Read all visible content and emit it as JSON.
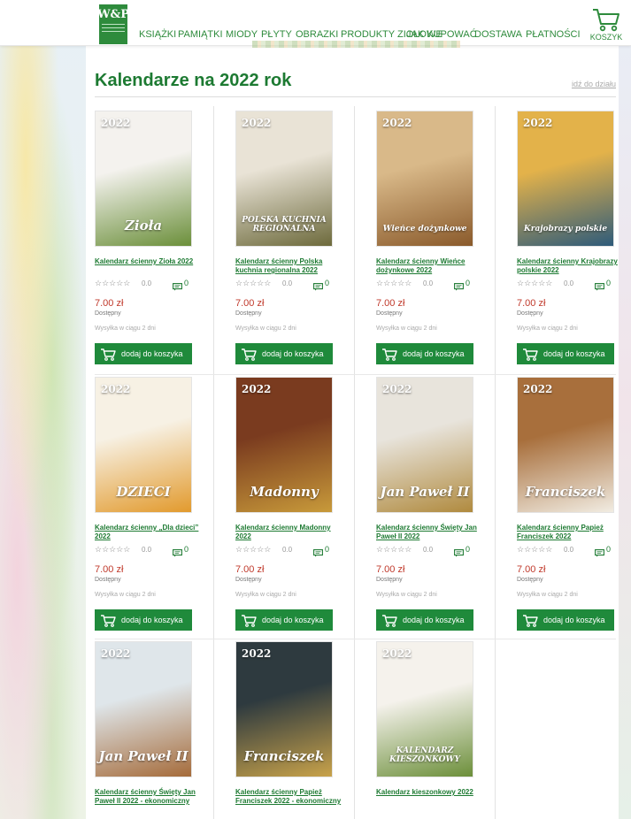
{
  "header": {
    "logo_text": "W&P",
    "nav": [
      {
        "label": "KSIĄŻKI"
      },
      {
        "label": "PAMIĄTKI"
      },
      {
        "label": "MIODY"
      },
      {
        "label": "PŁYTY"
      },
      {
        "label": "OBRAZKI"
      },
      {
        "label": "PRODUKTY ZIOŁOWE"
      },
      {
        "label": "JAK KUPOWAĆ"
      },
      {
        "label": "DOSTAWA"
      },
      {
        "label": "PŁATNOŚCI"
      }
    ],
    "cart_label": "KOSZYK"
  },
  "page": {
    "title": "Kalendarze na 2022 rok",
    "goto_label": "idź do działu"
  },
  "products": [
    {
      "name": "Kalendarz ścienny Zioła 2022",
      "cover_title": "Zioła",
      "cover_year": "2022",
      "rating": "0.0",
      "comments": "0",
      "price": "7.00 zł",
      "availability": "Dostępny",
      "shipping": "Wysyłka w ciągu 2 dni",
      "button": "dodaj do koszyka",
      "colors": [
        "#f4f2ee",
        "#6b8f3a"
      ]
    },
    {
      "name": "Kalendarz ścienny Polska kuchnia regionalna 2022",
      "cover_title": "POLSKA KUCHNIA REGIONALNA",
      "cover_year": "2022",
      "rating": "0.0",
      "comments": "0",
      "price": "7.00 zł",
      "availability": "Dostępny",
      "shipping": "Wysyłka w ciągu 2 dni",
      "button": "dodaj do koszyka",
      "colors": [
        "#e9e3d6",
        "#6d6a3c"
      ]
    },
    {
      "name": "Kalendarz ścienny Wieńce dożynkowe 2022",
      "cover_title": "Wieńce dożynkowe",
      "cover_year": "2022",
      "rating": "0.0",
      "comments": "0",
      "price": "7.00 zł",
      "availability": "Dostępny",
      "shipping": "Wysyłka w ciągu 2 dni",
      "button": "dodaj do koszyka",
      "colors": [
        "#d9b989",
        "#8a5a2b"
      ]
    },
    {
      "name": "Kalendarz ścienny Krajobrazy polskie 2022",
      "cover_title": "Krajobrazy polskie",
      "cover_year": "2022",
      "rating": "0.0",
      "comments": "0",
      "price": "7.00 zł",
      "availability": "Dostępny",
      "shipping": "Wysyłka w ciągu 2 dni",
      "button": "dodaj do koszyka",
      "colors": [
        "#e3b24a",
        "#2e5b7a"
      ]
    },
    {
      "name": "Kalendarz ścienny „Dla dzieci” 2022",
      "cover_title": "DZIECI",
      "cover_year": "2022",
      "rating": "0.0",
      "comments": "0",
      "price": "7.00 zł",
      "availability": "Dostępny",
      "shipping": "Wysyłka w ciągu 2 dni",
      "button": "dodaj do koszyka",
      "colors": [
        "#f7f1e4",
        "#e29a2d"
      ]
    },
    {
      "name": "Kalendarz ścienny Madonny 2022",
      "cover_title": "Madonny",
      "cover_year": "2022",
      "rating": "0.0",
      "comments": "0",
      "price": "7.00 zł",
      "availability": "Dostępny",
      "shipping": "Wysyłka w ciągu 2 dni",
      "button": "dodaj do koszyka",
      "colors": [
        "#7a3b1f",
        "#c89a3a"
      ]
    },
    {
      "name": "Kalendarz ścienny Święty Jan Paweł II 2022",
      "cover_title": "Jan Paweł II",
      "cover_year": "2022",
      "rating": "0.0",
      "comments": "0",
      "price": "7.00 zł",
      "availability": "Dostępny",
      "shipping": "Wysyłka w ciągu 2 dni",
      "button": "dodaj do koszyka",
      "colors": [
        "#e8e4dc",
        "#b08a3e"
      ]
    },
    {
      "name": "Kalendarz ścienny Papież Franciszek 2022",
      "cover_title": "Franciszek",
      "cover_year": "2022",
      "rating": "0.0",
      "comments": "0",
      "price": "7.00 zł",
      "availability": "Dostępny",
      "shipping": "Wysyłka w ciągu 2 dni",
      "button": "dodaj do koszyka",
      "colors": [
        "#a86f3c",
        "#f1ece2"
      ]
    },
    {
      "name": "Kalendarz ścienny Święty Jan Paweł II 2022 - ekonomiczny",
      "cover_title": "Jan Paweł II",
      "cover_year": "2022",
      "colors": [
        "#dfe6ea",
        "#a56b3a"
      ]
    },
    {
      "name": "Kalendarz ścienny Papież Franciszek 2022 - ekonomiczny",
      "cover_title": "Franciszek",
      "cover_year": "2022",
      "colors": [
        "#2e3a3f",
        "#c8a24a"
      ]
    },
    {
      "name": "Kalendarz kieszonkowy 2022",
      "cover_title": "KALENDARZ KIESZONKOWY",
      "cover_year": "2022",
      "colors": [
        "#f5f2ec",
        "#6c8f3a"
      ]
    }
  ]
}
